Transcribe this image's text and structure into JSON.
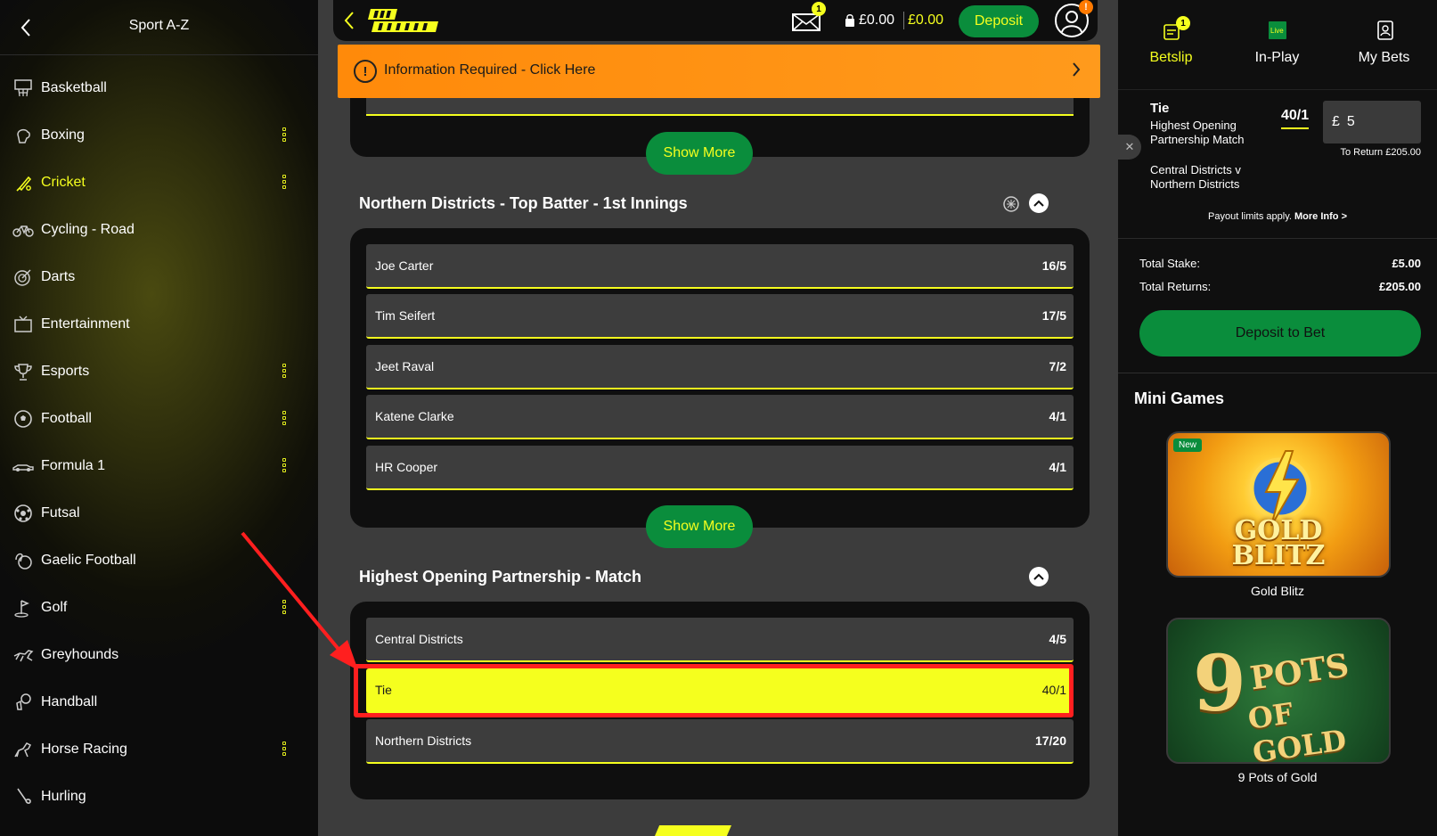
{
  "sidebar": {
    "title": "Sport A-Z",
    "items": [
      {
        "label": "Basketball",
        "icon": "basketball-hoop-icon",
        "dots": false
      },
      {
        "label": "Boxing",
        "icon": "boxing-glove-icon",
        "dots": true
      },
      {
        "label": "Cricket",
        "icon": "cricket-bat-icon",
        "dots": true,
        "active": true
      },
      {
        "label": "Cycling - Road",
        "icon": "bicycle-icon",
        "dots": false
      },
      {
        "label": "Darts",
        "icon": "dartboard-icon",
        "dots": false
      },
      {
        "label": "Entertainment",
        "icon": "tv-icon",
        "dots": false
      },
      {
        "label": "Esports",
        "icon": "trophy-icon",
        "dots": true
      },
      {
        "label": "Football",
        "icon": "football-icon",
        "dots": true
      },
      {
        "label": "Formula 1",
        "icon": "race-car-icon",
        "dots": true
      },
      {
        "label": "Futsal",
        "icon": "futsal-ball-icon",
        "dots": false
      },
      {
        "label": "Gaelic Football",
        "icon": "gaelic-football-icon",
        "dots": false
      },
      {
        "label": "Golf",
        "icon": "golf-flag-icon",
        "dots": true
      },
      {
        "label": "Greyhounds",
        "icon": "greyhound-icon",
        "dots": false
      },
      {
        "label": "Handball",
        "icon": "handball-icon",
        "dots": false
      },
      {
        "label": "Horse Racing",
        "icon": "horse-icon",
        "dots": true
      },
      {
        "label": "Hurling",
        "icon": "hurling-stick-icon",
        "dots": false
      }
    ]
  },
  "topbar": {
    "mail_badge": "1",
    "balance_cash": "£0.00",
    "balance_bonus": "£0.00",
    "deposit_label": "Deposit",
    "account_alert": "!"
  },
  "info_banner": {
    "icon_text": "!",
    "text": "Information Required - Click Here"
  },
  "show_more_label": "Show More",
  "markets": [
    {
      "title": "Northern Districts - Top Batter - 1st Innings",
      "rows": [
        {
          "name": "Joe Carter",
          "odds": "16/5"
        },
        {
          "name": "Tim Seifert",
          "odds": "17/5"
        },
        {
          "name": "Jeet Raval",
          "odds": "7/2"
        },
        {
          "name": "Katene Clarke",
          "odds": "4/1"
        },
        {
          "name": "HR Cooper",
          "odds": "4/1"
        }
      ]
    },
    {
      "title": "Highest Opening Partnership - Match",
      "rows": [
        {
          "name": "Central Districts",
          "odds": "4/5"
        },
        {
          "name": "Tie",
          "odds": "40/1",
          "selected": true
        },
        {
          "name": "Northern Districts",
          "odds": "17/20"
        }
      ]
    }
  ],
  "right_panel": {
    "tabs": [
      {
        "label": "Betslip",
        "icon": "betslip-icon",
        "badge": "1",
        "active": true
      },
      {
        "label": "In-Play",
        "icon": "live-icon",
        "badge_text": "Live"
      },
      {
        "label": "My Bets",
        "icon": "my-bets-icon"
      }
    ],
    "slip": {
      "close": "✕",
      "selection": "Tie",
      "market": "Highest Opening Partnership Match",
      "event": "Central Districts v Northern Districts",
      "odds": "40/1",
      "currency": "£",
      "stake": "5",
      "to_return": "To Return £205.00",
      "payout_note": "Payout limits apply.",
      "more_info": "More Info >"
    },
    "totals": {
      "stake_label": "Total Stake:",
      "stake_value": "£5.00",
      "returns_label": "Total Returns:",
      "returns_value": "£205.00"
    },
    "deposit_to_bet": "Deposit to Bet",
    "mini_games": {
      "title": "Mini Games",
      "games": [
        {
          "name": "Gold Blitz",
          "badge": "New",
          "art_text_1": "GOLD",
          "art_text_2": "BLITZ"
        },
        {
          "name": "9 Pots of Gold",
          "art_text_1": "9",
          "art_text_2": "POTS",
          "art_text_3": "OF GOLD"
        }
      ]
    }
  },
  "colors": {
    "accent_yellow": "#f5ff1e",
    "brand_green": "#0a8d3c",
    "banner_orange": "#ff8a0a",
    "highlight_red": "#ff1f1f"
  }
}
